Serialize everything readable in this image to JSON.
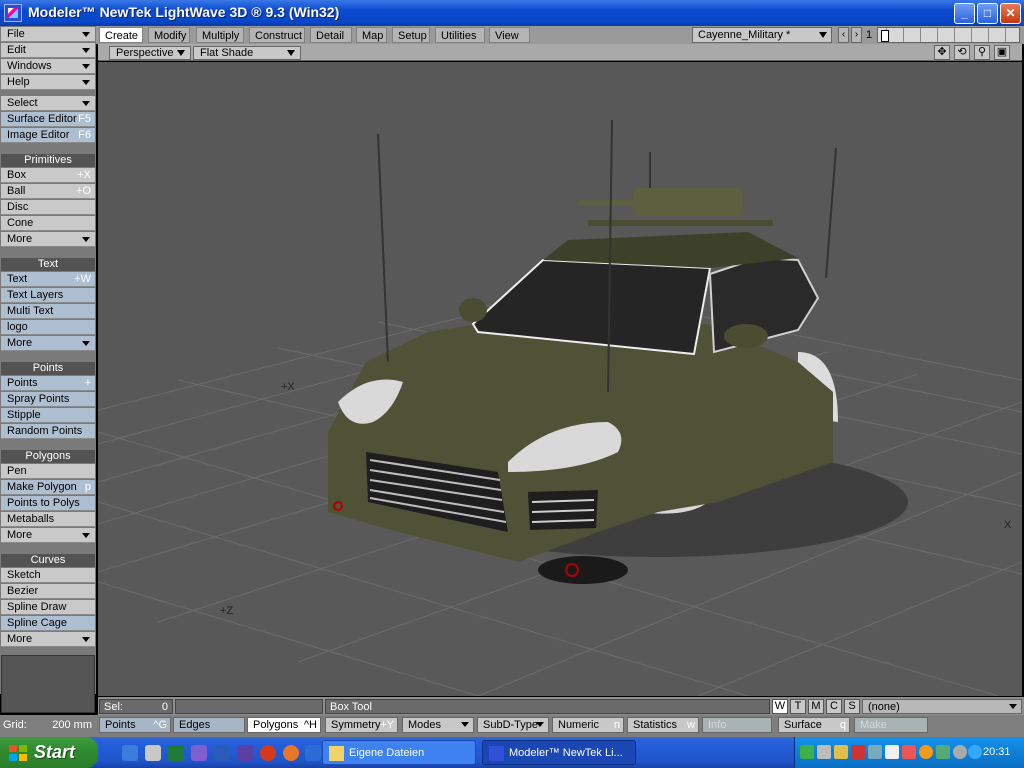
{
  "window": {
    "title": "Modeler™ NewTek LightWave 3D ® 9.3 (Win32)",
    "buttons": [
      "_",
      "□",
      "✕"
    ]
  },
  "sidebar": {
    "menus": [
      {
        "label": "File"
      },
      {
        "label": "Edit"
      },
      {
        "label": "Windows"
      },
      {
        "label": "Help"
      }
    ],
    "select": "Select",
    "editors": [
      {
        "label": "Surface Editor",
        "shortcut": "F5"
      },
      {
        "label": "Image Editor",
        "shortcut": "F6"
      }
    ],
    "groups": [
      {
        "title": "Primitives",
        "items": [
          {
            "label": "Box",
            "shortcut": "+X"
          },
          {
            "label": "Ball",
            "shortcut": "+O"
          },
          {
            "label": "Disc",
            "shortcut": ""
          },
          {
            "label": "Cone",
            "shortcut": ""
          },
          {
            "label": "More",
            "shortcut": ""
          }
        ]
      },
      {
        "title": "Text",
        "items": [
          {
            "label": "Text",
            "shortcut": "+W"
          },
          {
            "label": "Text Layers",
            "shortcut": ""
          },
          {
            "label": "Multi Text",
            "shortcut": ""
          },
          {
            "label": "logo",
            "shortcut": ""
          },
          {
            "label": "More",
            "shortcut": ""
          }
        ]
      },
      {
        "title": "Points",
        "items": [
          {
            "label": "Points",
            "shortcut": "+"
          },
          {
            "label": "Spray Points",
            "shortcut": ""
          },
          {
            "label": "Stipple",
            "shortcut": ""
          },
          {
            "label": "Random Points",
            "shortcut": ""
          }
        ]
      },
      {
        "title": "Polygons",
        "items": [
          {
            "label": "Pen",
            "shortcut": ""
          },
          {
            "label": "Make Polygon",
            "shortcut": "p"
          },
          {
            "label": "Points to Polys",
            "shortcut": ""
          },
          {
            "label": "Metaballs",
            "shortcut": ""
          },
          {
            "label": "More",
            "shortcut": ""
          }
        ]
      },
      {
        "title": "Curves",
        "items": [
          {
            "label": "Sketch",
            "shortcut": ""
          },
          {
            "label": "Bezier",
            "shortcut": ""
          },
          {
            "label": "Spline Draw",
            "shortcut": ""
          },
          {
            "label": "Spline Cage",
            "shortcut": ""
          },
          {
            "label": "More",
            "shortcut": ""
          }
        ]
      }
    ]
  },
  "tabs": [
    {
      "label": "Create",
      "active": true
    },
    {
      "label": "Modify"
    },
    {
      "label": "Multiply"
    },
    {
      "label": "Construct"
    },
    {
      "label": "Detail"
    },
    {
      "label": "Map"
    },
    {
      "label": "Setup"
    },
    {
      "label": "Utilities"
    },
    {
      "label": "View"
    }
  ],
  "surface_selector": {
    "value": "Cayenne_Military *"
  },
  "layer": {
    "current": "1"
  },
  "viewport": {
    "view_mode": "Perspective",
    "shading": "Flat Shade",
    "axes": {
      "x": "+X",
      "z": "+Z",
      "x_far": "X"
    },
    "icons": [
      "move-icon",
      "rotate-icon",
      "zoom-icon",
      "maximize-icon"
    ]
  },
  "status": {
    "sel_label": "Sel:",
    "sel_value": "0",
    "tool": "Box Tool",
    "wtmcs": [
      "W",
      "T",
      "M",
      "C",
      "S"
    ],
    "surface_value": "(none)"
  },
  "bottom": {
    "grid_label": "Grid:",
    "grid_value": "200 mm",
    "points": {
      "label": "Points",
      "shortcut": "^G"
    },
    "edges": {
      "label": "Edges"
    },
    "polygons": {
      "label": "Polygons",
      "shortcut": "^H"
    },
    "symmetry": {
      "label": "Symmetry",
      "shortcut": "+Y"
    },
    "modes": "Modes",
    "subd": "SubD-Type",
    "numeric": {
      "label": "Numeric",
      "shortcut": "n"
    },
    "statistics": {
      "label": "Statistics",
      "shortcut": "w"
    },
    "info": "Info",
    "surface": {
      "label": "Surface",
      "shortcut": "q"
    },
    "make": "Make"
  },
  "taskbar": {
    "start": "Start",
    "tasks": [
      {
        "label": "Eigene Dateien"
      },
      {
        "label": "Modeler™ NewTek Li..."
      }
    ],
    "clock": "20:31"
  }
}
